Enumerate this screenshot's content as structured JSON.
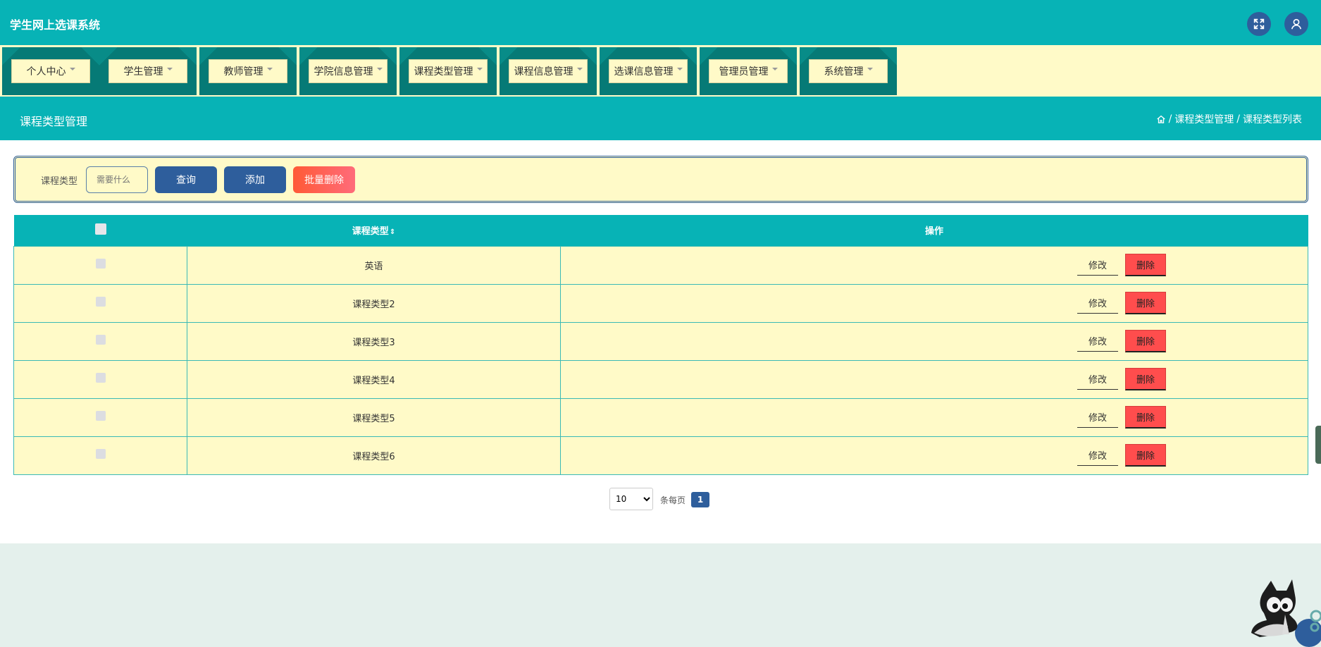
{
  "app": {
    "title": "学生网上选课系统"
  },
  "nav": {
    "items": [
      {
        "label": "个人中心"
      },
      {
        "label": "学生管理"
      },
      {
        "label": "教师管理"
      },
      {
        "label": "学院信息管理"
      },
      {
        "label": "课程类型管理"
      },
      {
        "label": "课程信息管理"
      },
      {
        "label": "选课信息管理"
      },
      {
        "label": "管理员管理"
      },
      {
        "label": "系统管理"
      }
    ]
  },
  "page": {
    "title": "课程类型管理",
    "breadcrumb": [
      "课程类型管理",
      "课程类型列表"
    ],
    "separator": "/"
  },
  "search": {
    "label": "课程类型",
    "placeholder": "需要什么",
    "query_button": "查询",
    "add_button": "添加",
    "batch_delete_button": "批量删除"
  },
  "table": {
    "headers": {
      "type": "课程类型",
      "sort_icon": "⇕",
      "ops": "操作"
    },
    "rows": [
      {
        "type": "英语"
      },
      {
        "type": "课程类型2"
      },
      {
        "type": "课程类型3"
      },
      {
        "type": "课程类型4"
      },
      {
        "type": "课程类型5"
      },
      {
        "type": "课程类型6"
      }
    ],
    "edit_label": "修改",
    "delete_label": "删除"
  },
  "pagination": {
    "page_size": "10",
    "page_size_options": [
      "10"
    ],
    "per_page_label": "条每页",
    "current_page": "1"
  },
  "icons": {
    "fullscreen": "fullscreen-icon",
    "user": "user-icon",
    "home": "home-icon"
  },
  "colors": {
    "primary": "#07b3b6",
    "nav_bg": "#fffac8",
    "button_blue": "#2e5e9c",
    "danger": "#ff4d4d"
  }
}
